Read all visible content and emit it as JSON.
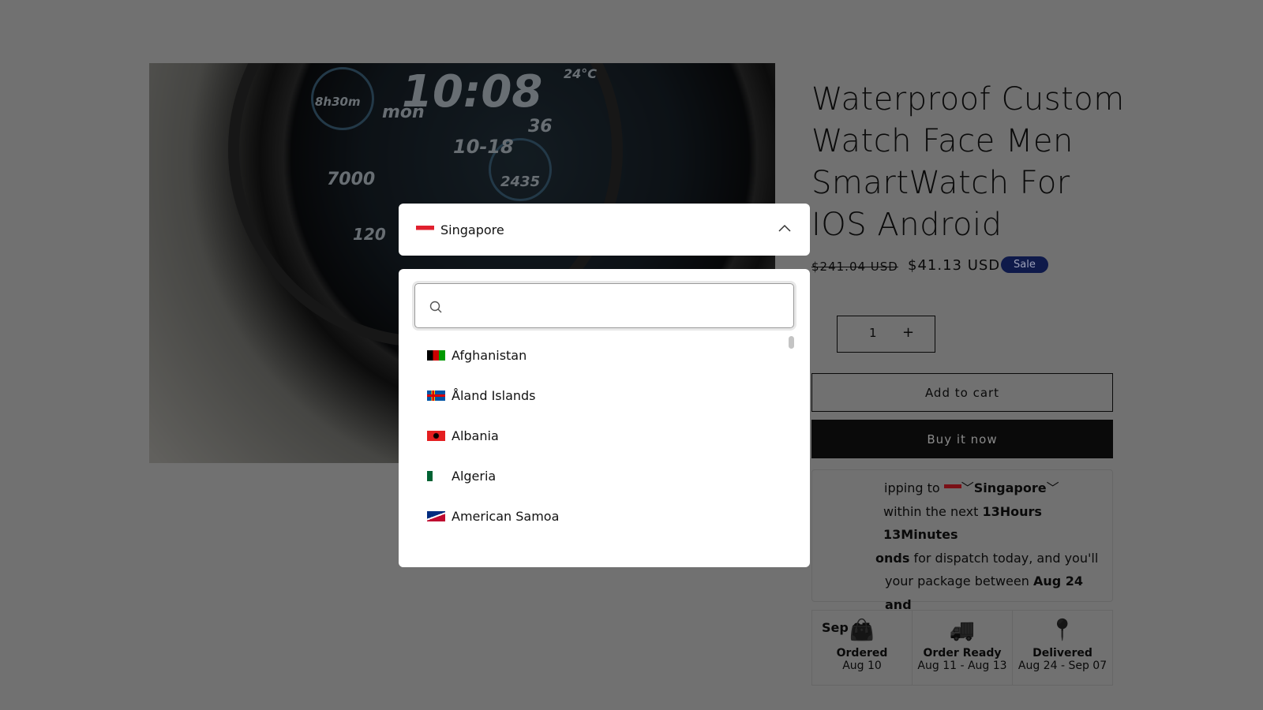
{
  "product": {
    "title": "Waterproof Custom Watch Face Men SmartWatch For IOS Android",
    "title_visible_tail": "droid",
    "old_price": "$241.04 USD",
    "price": "$41.13 USD",
    "sale_badge": "Sale",
    "quantity": "1",
    "plus": "+",
    "add_to_cart": "Add to cart",
    "buy_now": "Buy it now"
  },
  "watch": {
    "time": "10:08",
    "seconds": "36",
    "day": "mon",
    "date": "10-18",
    "temp": "24°C",
    "sleep": "8h30m",
    "steps": "7000",
    "calories": "2435",
    "heart": "120"
  },
  "shipping": {
    "l1a": "ipping to",
    "l1b": "Singapore",
    "l2a": "within the next ",
    "l2b": "13Hours 13Minutes",
    "l3a": "onds",
    "l3b": " for dispatch today, and you'll",
    "l4a": "your package between ",
    "l4b": "Aug 24 and",
    "l5": "Sep 07"
  },
  "steps": [
    {
      "name": "Ordered",
      "date": "Aug 10",
      "icon": "shopping-bag-check-icon"
    },
    {
      "name": "Order Ready",
      "date": "Aug 11 - Aug 13",
      "icon": "delivery-truck-icon"
    },
    {
      "name": "Delivered",
      "date": "Aug 24 - Sep 07",
      "icon": "map-pin-icon"
    }
  ],
  "country_select": {
    "selected": "Singapore",
    "search_placeholder": "",
    "options": [
      "Afghanistan",
      "Åland Islands",
      "Albania",
      "Algeria",
      "American Samoa"
    ]
  }
}
